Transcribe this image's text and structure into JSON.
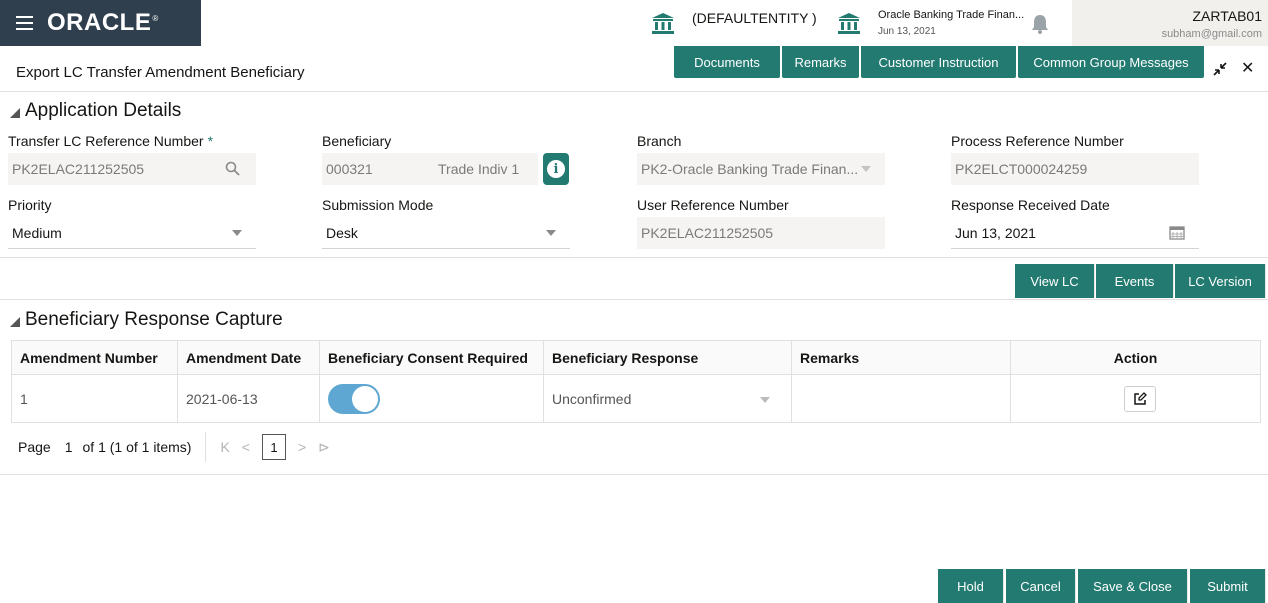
{
  "header": {
    "logo": "ORACLE",
    "entity": "(DEFAULTENTITY )",
    "app_name": "Oracle Banking Trade Finan...",
    "app_date": "Jun 13, 2021",
    "user_name": "ZARTAB01",
    "user_email": "subham@gmail.com"
  },
  "title_row": {
    "title": "Export LC Transfer Amendment Beneficiary",
    "tabs": [
      "Documents",
      "Remarks",
      "Customer Instruction",
      "Common Group Messages"
    ]
  },
  "application_details": {
    "section_title": "Application Details",
    "transfer_ref_label": "Transfer LC Reference Number",
    "required_mark": "*",
    "transfer_ref_value": "PK2ELAC211252505",
    "beneficiary_label": "Beneficiary",
    "beneficiary_id": "000321",
    "beneficiary_name": "Trade Indiv 1",
    "info_glyph": "i",
    "branch_label": "Branch",
    "branch_value": "PK2-Oracle Banking Trade Finan...",
    "process_ref_label": "Process Reference Number",
    "process_ref_value": "PK2ELCT000024259",
    "priority_label": "Priority",
    "priority_value": "Medium",
    "submission_label": "Submission Mode",
    "submission_value": "Desk",
    "user_ref_label": "User Reference Number",
    "user_ref_value": "PK2ELAC211252505",
    "response_date_label": "Response Received Date",
    "response_date_value": "Jun 13, 2021"
  },
  "lc_buttons": [
    "View LC",
    "Events",
    "LC Version"
  ],
  "beneficiary_response": {
    "section_title": "Beneficiary Response Capture",
    "columns": [
      "Amendment Number",
      "Amendment Date",
      "Beneficiary Consent Required",
      "Beneficiary Response",
      "Remarks",
      "Action"
    ],
    "rows": [
      {
        "amendment_number": "1",
        "amendment_date": "2021-06-13",
        "consent_required": true,
        "response": "Unconfirmed",
        "remarks": ""
      }
    ]
  },
  "pagination": {
    "page_label": "Page",
    "page_value": "1",
    "of_text": "of 1  (1 of 1 items)",
    "first": "K",
    "prev": "<",
    "current": "1",
    "next": ">",
    "last": "⊳"
  },
  "footer_buttons": [
    "Hold",
    "Cancel",
    "Save & Close",
    "Submit"
  ],
  "colors": {
    "accent": "#227a70",
    "nav": "#2f3f4d",
    "toggle": "#5fa7d3"
  }
}
